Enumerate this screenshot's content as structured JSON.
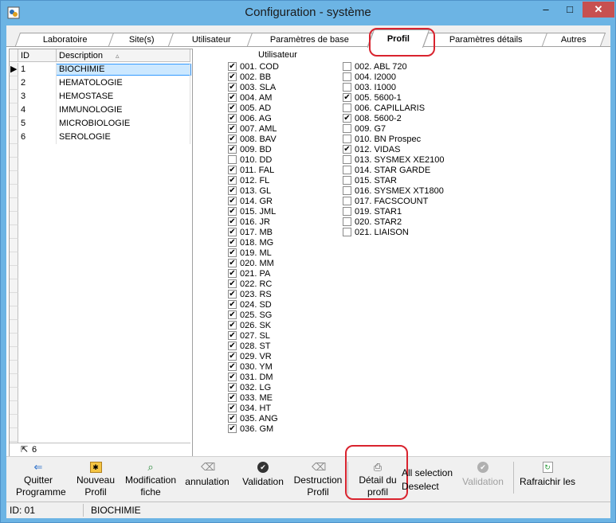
{
  "window": {
    "title": "Configuration - système",
    "minimize": "–",
    "maximize": "□",
    "close": "✕"
  },
  "tabs": [
    {
      "label": "Laboratoire",
      "active": false
    },
    {
      "label": "Site(s)",
      "active": false
    },
    {
      "label": "Utilisateur",
      "active": false
    },
    {
      "label": "Paramètres de base",
      "active": false
    },
    {
      "label": "Profil",
      "active": true
    },
    {
      "label": "Paramètres détails",
      "active": false
    },
    {
      "label": "Autres",
      "active": false
    }
  ],
  "grid": {
    "columns": [
      "ID",
      "Description"
    ],
    "rows": [
      {
        "id": "1",
        "description": "BIOCHIMIE"
      },
      {
        "id": "2",
        "description": "HEMATOLOGIE"
      },
      {
        "id": "3",
        "description": "HEMOSTASE"
      },
      {
        "id": "4",
        "description": "IMMUNOLOGIE"
      },
      {
        "id": "5",
        "description": "MICROBIOLOGIE"
      },
      {
        "id": "6",
        "description": "SEROLOGIE"
      }
    ],
    "selected_index": 0,
    "footer_count": "6"
  },
  "utilisateur_label": "Utilisateur",
  "users": [
    {
      "label": "001. COD",
      "checked": true
    },
    {
      "label": "002. BB",
      "checked": true
    },
    {
      "label": "003. SLA",
      "checked": true
    },
    {
      "label": "004. AM",
      "checked": true
    },
    {
      "label": "005. AD",
      "checked": true
    },
    {
      "label": "006. AG",
      "checked": true
    },
    {
      "label": "007. AML",
      "checked": true
    },
    {
      "label": "008. BAV",
      "checked": true
    },
    {
      "label": "009. BD",
      "checked": true
    },
    {
      "label": "010. DD",
      "checked": false
    },
    {
      "label": "011. FAL",
      "checked": true
    },
    {
      "label": "012. FL",
      "checked": true
    },
    {
      "label": "013. GL",
      "checked": true
    },
    {
      "label": "014. GR",
      "checked": true
    },
    {
      "label": "015. JML",
      "checked": true
    },
    {
      "label": "016. JR",
      "checked": true
    },
    {
      "label": "017. MB",
      "checked": true
    },
    {
      "label": "018. MG",
      "checked": true
    },
    {
      "label": "019. ML",
      "checked": true
    },
    {
      "label": "020. MM",
      "checked": true
    },
    {
      "label": "021. PA",
      "checked": true
    },
    {
      "label": "022. RC",
      "checked": true
    },
    {
      "label": "023. RS",
      "checked": true
    },
    {
      "label": "024. SD",
      "checked": true
    },
    {
      "label": "025. SG",
      "checked": true
    },
    {
      "label": "026. SK",
      "checked": true
    },
    {
      "label": "027. SL",
      "checked": true
    },
    {
      "label": "028. ST",
      "checked": true
    },
    {
      "label": "029. VR",
      "checked": true
    },
    {
      "label": "030. YM",
      "checked": true
    },
    {
      "label": "031. DM",
      "checked": true
    },
    {
      "label": "032. LG",
      "checked": true
    },
    {
      "label": "033. ME",
      "checked": true
    },
    {
      "label": "034. HT",
      "checked": true
    },
    {
      "label": "035. ANG",
      "checked": true
    },
    {
      "label": "036. GM",
      "checked": true
    }
  ],
  "instruments": [
    {
      "label": "002. ABL 720",
      "checked": false
    },
    {
      "label": "004. I2000",
      "checked": false
    },
    {
      "label": "003. I1000",
      "checked": false
    },
    {
      "label": "005. 5600-1",
      "checked": true
    },
    {
      "label": "006. CAPILLARIS",
      "checked": false
    },
    {
      "label": "008. 5600-2",
      "checked": true
    },
    {
      "label": "009. G7",
      "checked": false
    },
    {
      "label": "010. BN Prospec",
      "checked": false
    },
    {
      "label": "012. VIDAS",
      "checked": true
    },
    {
      "label": "013. SYSMEX XE2100",
      "checked": false
    },
    {
      "label": "014. STAR GARDE",
      "checked": false
    },
    {
      "label": "015. STAR",
      "checked": false
    },
    {
      "label": "016. SYSMEX XT1800",
      "checked": false
    },
    {
      "label": "017. FACSCOUNT",
      "checked": false
    },
    {
      "label": "019. STAR1",
      "checked": false
    },
    {
      "label": "020. STAR2",
      "checked": false
    },
    {
      "label": "021. LIAISON",
      "checked": false
    }
  ],
  "toolbar": {
    "quitter_1": "Quitter",
    "quitter_2": "Programme",
    "nouveau_1": "Nouveau",
    "nouveau_2": "Profil",
    "modification_1": "Modification",
    "modification_2": "fiche",
    "annulation": "annulation",
    "validation": "Validation",
    "destruction_1": "Destruction",
    "destruction_2": "Profil",
    "detail_1": "Détail du",
    "detail_2": "profil",
    "all_selection": "All selection",
    "deselect": "Deselect",
    "validation2": "Validation",
    "rafraichir": "Rafraichir les"
  },
  "status": {
    "id": "ID: 01",
    "description": "BIOCHIMIE"
  },
  "colors": {
    "title_bar": "#6cb4e4",
    "close_button": "#c75050",
    "selection": "#cce8ff",
    "annotation": "#d9232e"
  }
}
